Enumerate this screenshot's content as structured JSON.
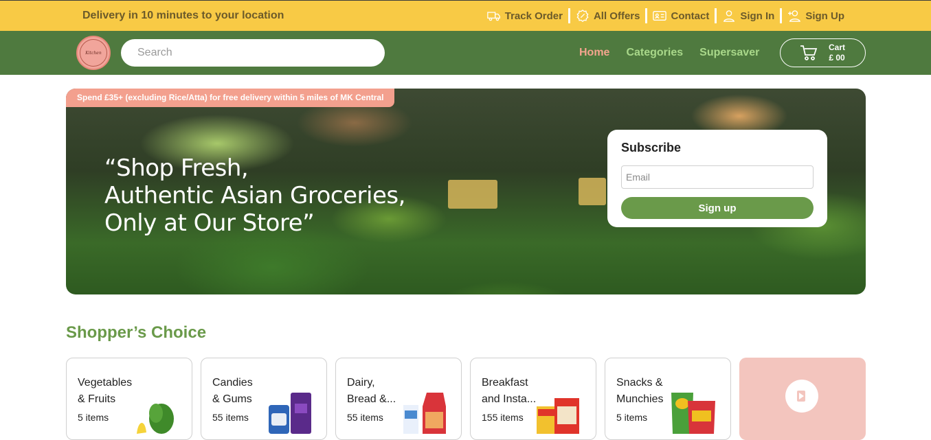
{
  "topbar": {
    "delivery_text": "Delivery in 10 minutes to your location",
    "links": [
      {
        "label": "Track Order",
        "icon": "truck-icon"
      },
      {
        "label": "All Offers",
        "icon": "offer-badge-icon"
      },
      {
        "label": "Contact",
        "icon": "contact-card-icon"
      },
      {
        "label": "Sign In",
        "icon": "user-icon"
      },
      {
        "label": "Sign Up",
        "icon": "user-plus-icon"
      }
    ],
    "color": "#f8ca45"
  },
  "nav": {
    "logo_text": "Kitchen",
    "search_placeholder": "Search",
    "links": {
      "home": "Home",
      "categories": "Categories",
      "supersaver": "Supersaver"
    },
    "cart": {
      "label": "Cart",
      "amount": "£ 00"
    },
    "color": "#4f7a3f"
  },
  "hero": {
    "banner": "Spend £35+ (excluding Rice/Atta) for free delivery within 5 miles of MK Central",
    "quote_line1": "“Shop Fresh,",
    "quote_line2": "Authentic Asian Groceries,",
    "quote_line3": "Only at Our Store”",
    "subscribe": {
      "title": "Subscribe",
      "email_placeholder": "Email",
      "button": "Sign up"
    }
  },
  "shoppers_choice": {
    "title": "Shopper’s Choice",
    "cards": [
      {
        "line1": "Vegetables",
        "line2": "& Fruits",
        "count": "5 items"
      },
      {
        "line1": "Candies",
        "line2": "& Gums",
        "count": "55 items"
      },
      {
        "line1": "Dairy,",
        "line2": "Bread &...",
        "count": "55 items"
      },
      {
        "line1": "Breakfast",
        "line2": "and Insta...",
        "count": "155 items"
      },
      {
        "line1": "Snacks &",
        "line2": "Munchies",
        "count": "5 items"
      }
    ]
  }
}
